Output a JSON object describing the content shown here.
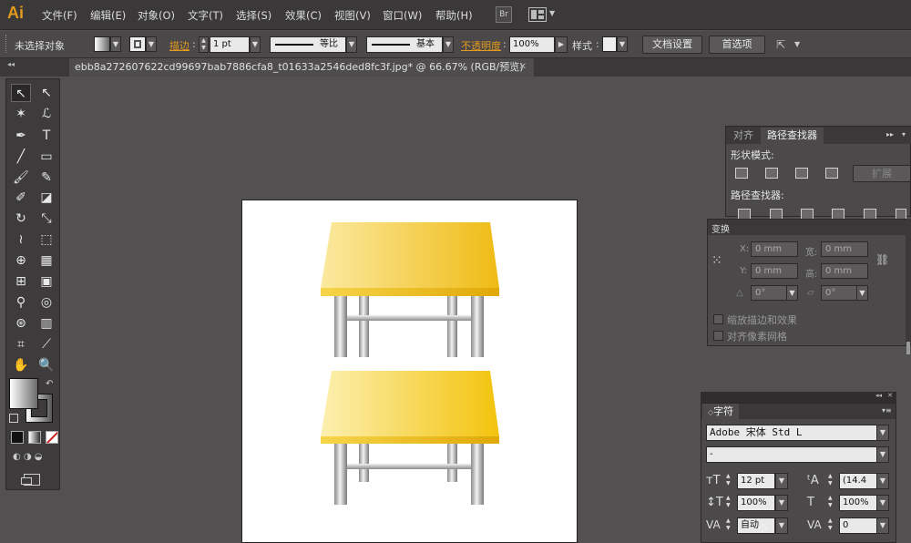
{
  "menubar": {
    "logo": "Ai",
    "items": [
      "文件(F)",
      "编辑(E)",
      "对象(O)",
      "文字(T)",
      "选择(S)",
      "效果(C)",
      "视图(V)",
      "窗口(W)",
      "帮助(H)"
    ],
    "bridge_label": "Br"
  },
  "control_bar": {
    "selection_status": "未选择对象",
    "stroke_label": "描边",
    "stroke_weight": "1 pt",
    "stroke_profile": "等比",
    "brush_label": "基本",
    "opacity_label": "不透明度",
    "opacity_value": "100%",
    "style_label": "样式",
    "doc_setup_button": "文档设置",
    "preferences_button": "首选项"
  },
  "document_tab": {
    "label": "ebb8a272607622cd99697bab7886cfa8_t01633a2546ded8fc3f.jpg*  @  66.67% (RGB/预览)",
    "close": "✕"
  },
  "pathfinder_panel": {
    "tabs": [
      "对齐",
      "路径查找器"
    ],
    "shape_modes_label": "形状模式:",
    "expand_button": "扩展",
    "pathfinders_label": "路径查找器:"
  },
  "transform_panel": {
    "title": "变换",
    "x_label": "X:",
    "x_value": "0 mm",
    "width_label": "宽:",
    "width_value": "0 mm",
    "y_label": "Y:",
    "y_value": "0 mm",
    "height_label": "高:",
    "height_value": "0 mm",
    "angle_value": "0°",
    "shear_value": "0°",
    "scale_strokes": "缩放描边和效果",
    "align_pixel": "对齐像素网格"
  },
  "character_panel": {
    "title": "字符",
    "font_family": "Adobe 宋体 Std L",
    "font_style": "-",
    "font_size": "12 pt",
    "leading": "(14.4",
    "vertical_scale": "100%",
    "horizontal_scale": "100%",
    "kerning": "自动",
    "tracking": "0"
  },
  "colors": {
    "accent_orange": "#e39a1d",
    "table_yellow": "#f2c21a"
  }
}
